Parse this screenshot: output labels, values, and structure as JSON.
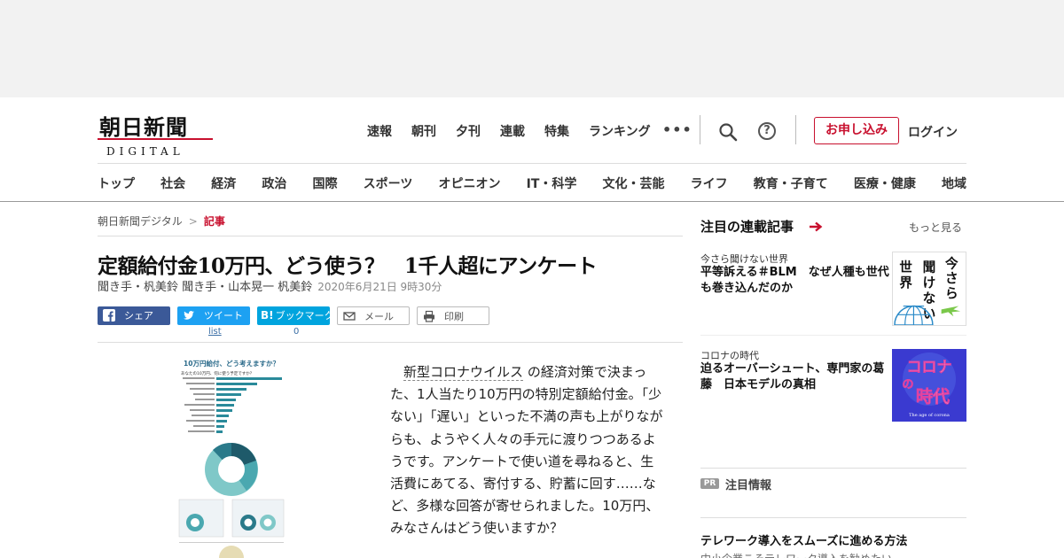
{
  "brand": {
    "logo_text": "朝日新聞",
    "logo_sub": "DIGITAL",
    "accent": "#c8102e"
  },
  "top_nav": [
    "速報",
    "朝刊",
    "夕刊",
    "連載",
    "特集",
    "ランキング"
  ],
  "header_actions": {
    "more": "•••",
    "help": "?",
    "subscribe": "お申し込み",
    "login": "ログイン"
  },
  "category_nav": [
    "トップ",
    "社会",
    "経済",
    "政治",
    "国際",
    "スポーツ",
    "オピニオン",
    "IT・科学",
    "文化・芸能",
    "ライフ",
    "教育・子育て",
    "医療・健康",
    "地域"
  ],
  "breadcrumb": {
    "home": "朝日新聞デジタル",
    "sep": ">",
    "current": "記事"
  },
  "article": {
    "title": "定額給付金10万円、どう使う？　1千人超にアンケート",
    "byline": "聞き手・杋美鈴 聞き手・山本晃一 杋美鈴",
    "date": "2020年6月21日 9時30分",
    "body_link": "新型コロナウイルス",
    "body_text": "の経済対策で決まった、1人当たり10万円の特別定額給付金。「少ない」「遅い」といった不満の声も上がりながらも、ようやく人々の手元に渡りつつあるようです。アンケートで使い道を尋ねると、生活費にあてる、寄付する、貯蓄に回す……など、多様な回答が寄せられました。10万円、みなさんはどう使いますか？"
  },
  "share": {
    "facebook": "シェア",
    "twitter": "ツイート",
    "hatena": "ブックマーク",
    "hatena_badge": "B!",
    "mail": "メール",
    "print": "印刷",
    "tweet_count": "list",
    "bookmark_count": "0"
  },
  "infographic": {
    "title": "10万円給付、どう考えますか？",
    "subtitle": "あなたの10万円、何に使う予定ですか？"
  },
  "sidebar": {
    "heading": "注目の連載記事",
    "more": "もっと見る",
    "series": [
      {
        "label": "今さら聞けない世界",
        "title": "平等訴える＃BLM　なぜ人種も世代も巻き込んだのか",
        "thumb_text": [
          "今",
          "さ",
          "ら",
          "聞",
          "け",
          "な",
          "い",
          "世",
          "界"
        ]
      },
      {
        "label": "コロナの時代",
        "title": "迫るオーバーシュート、専門家の葛藤　日本モデルの真相",
        "thumb_text": [
          "コロナ",
          "の",
          "時代"
        ],
        "thumb_sub": "The age of corona"
      }
    ],
    "pr": {
      "badge": "PR",
      "heading": "注目情報",
      "item_title": "テレワーク導入をスムーズに進める方法",
      "item_sub": "中小企業こそテレワーク導入を勧めたい"
    }
  }
}
